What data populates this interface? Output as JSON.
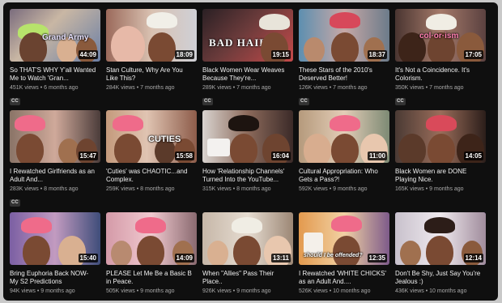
{
  "videos": [
    {
      "title": "So THAT'S WHY Y'all Wanted Me to Watch 'Gran...",
      "views": "451K views",
      "age": "6 months ago",
      "duration": "44:09",
      "cc": "CC",
      "overlay": "Grand Army"
    },
    {
      "title": "Stan Culture, Why Are You Like This?",
      "views": "284K views",
      "age": "7 months ago",
      "duration": "18:09",
      "cc": "",
      "overlay": ""
    },
    {
      "title": "Black Women Wear Weaves Because They're...",
      "views": "289K views",
      "age": "7 months ago",
      "duration": "19:15",
      "cc": "CC",
      "overlay": "BAD HAIR"
    },
    {
      "title": "These Stars of the 2010's Deserved Better!",
      "views": "126K views",
      "age": "7 months ago",
      "duration": "18:37",
      "cc": "CC",
      "overlay": ""
    },
    {
      "title": "It's Not a Coincidence. It's Colorism.",
      "views": "350K views",
      "age": "7 months ago",
      "duration": "17:05",
      "cc": "CC",
      "overlay": "col·or·ism"
    },
    {
      "title": "I Rewatched Girlfriends as an Adult And...",
      "views": "283K views",
      "age": "8 months ago",
      "duration": "15:47",
      "cc": "CC",
      "overlay": ""
    },
    {
      "title": "'Cuties' was CHAOTIC...and Complex.",
      "views": "259K views",
      "age": "8 months ago",
      "duration": "15:58",
      "cc": "",
      "overlay": "CUTIES"
    },
    {
      "title": "How 'Relationship Channels' Turned Into the YouTube...",
      "views": "315K views",
      "age": "8 months ago",
      "duration": "16:04",
      "cc": "",
      "overlay": ""
    },
    {
      "title": "Cultural Appropriation: Who Gets a Pass?!",
      "views": "592K views",
      "age": "9 months ago",
      "duration": "11:00",
      "cc": "",
      "overlay": ""
    },
    {
      "title": "Black Women are DONE Playing Nice.",
      "views": "165K views",
      "age": "9 months ago",
      "duration": "14:05",
      "cc": "",
      "overlay": ""
    },
    {
      "title": "Bring Euphoria Back NOW- My S2 Predictions",
      "views": "94K views",
      "age": "9 months ago",
      "duration": "15:40",
      "cc": "",
      "overlay": ""
    },
    {
      "title": "PLEASE Let Me Be a Basic B in Peace.",
      "views": "505K views",
      "age": "9 months ago",
      "duration": "14:09",
      "cc": "",
      "overlay": ""
    },
    {
      "title": "When \"Allies\" Pass Their Place..",
      "views": "926K views",
      "age": "9 months ago",
      "duration": "13:11",
      "cc": "",
      "overlay": ""
    },
    {
      "title": "I Rewatched 'WHITE CHICKS' as an Adult And....",
      "views": "526K views",
      "age": "10 months ago",
      "duration": "12:35",
      "cc": "",
      "overlay": "should I be offended?"
    },
    {
      "title": "Don't Be Shy, Just Say You're Jealous :)",
      "views": "436K views",
      "age": "10 months ago",
      "duration": "12:14",
      "cc": "",
      "overlay": ""
    }
  ],
  "separator": "•"
}
